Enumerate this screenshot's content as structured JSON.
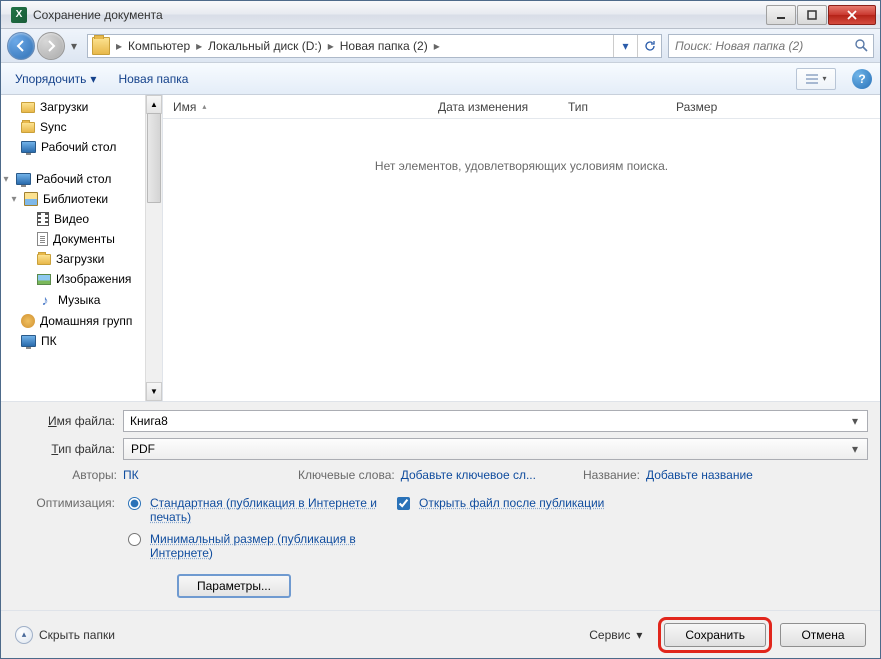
{
  "title": "Сохранение документа",
  "bg_app_title": "Microsoft Excel",
  "breadcrumb": {
    "parts": [
      "Компьютер",
      "Локальный диск (D:)",
      "Новая папка (2)"
    ]
  },
  "search": {
    "placeholder": "Поиск: Новая папка (2)"
  },
  "toolbar": {
    "organize": "Упорядочить",
    "newfolder": "Новая папка"
  },
  "tree": {
    "items1": [
      {
        "label": "Загрузки",
        "icon": "downloads"
      },
      {
        "label": "Sync",
        "icon": "folder"
      },
      {
        "label": "Рабочий стол",
        "icon": "monitor"
      }
    ],
    "desktop": "Рабочий стол",
    "libs": "Библиотеки",
    "libitems": [
      {
        "label": "Видео",
        "icon": "video"
      },
      {
        "label": "Документы",
        "icon": "doc"
      },
      {
        "label": "Загрузки",
        "icon": "folder"
      },
      {
        "label": "Изображения",
        "icon": "img"
      },
      {
        "label": "Музыка",
        "icon": "music"
      }
    ],
    "homegroup": "Домашняя групп",
    "pc": "ПК"
  },
  "columns": {
    "name": "Имя",
    "date": "Дата изменения",
    "type": "Тип",
    "size": "Размер"
  },
  "empty_text": "Нет элементов, удовлетворяющих условиям поиска.",
  "fields": {
    "filename_label": "Имя файла:",
    "filename_value": "Книга8",
    "filetype_label": "Тип файла:",
    "filetype_value": "PDF"
  },
  "meta": {
    "authors_label": "Авторы:",
    "authors_value": "ПК",
    "keywords_label": "Ключевые слова:",
    "keywords_value": "Добавьте ключевое сл...",
    "title_label": "Название:",
    "title_value": "Добавьте название"
  },
  "optimization": {
    "label": "Оптимизация:",
    "opt1": "Стандартная (публикация в Интернете и печать)",
    "opt2": "Минимальный размер (публикация в Интернете)",
    "open_after": "Открыть файл после публикации",
    "params": "Параметры..."
  },
  "footer": {
    "hide": "Скрыть папки",
    "service": "Сервис",
    "save": "Сохранить",
    "cancel": "Отмена"
  }
}
